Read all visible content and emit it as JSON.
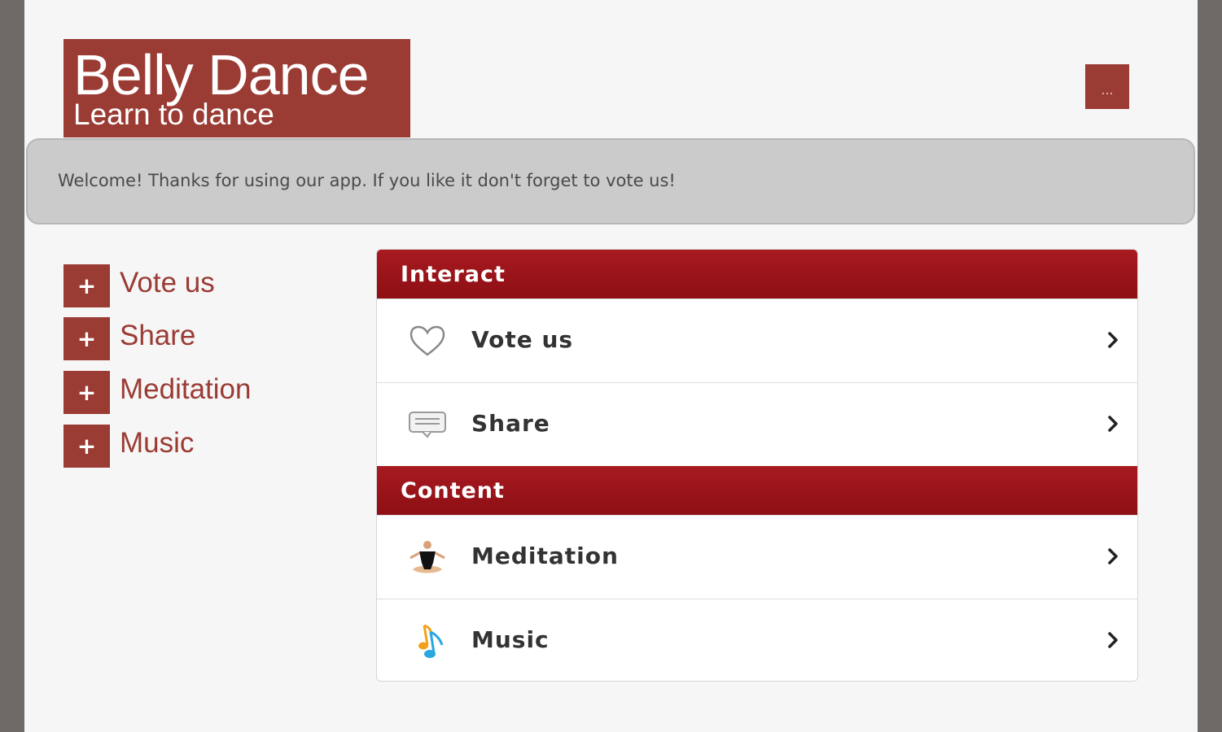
{
  "header": {
    "title": "Belly Dance",
    "subtitle": "Learn to dance",
    "more_label": "..."
  },
  "welcome": {
    "text": "Welcome! Thanks for using our app. If you like it don't forget to vote us!"
  },
  "side_nav": {
    "items": [
      {
        "icon": "+",
        "label": "Vote us"
      },
      {
        "icon": "+",
        "label": "Share"
      },
      {
        "icon": "+",
        "label": "Meditation"
      },
      {
        "icon": "+",
        "label": "Music"
      }
    ]
  },
  "sections": [
    {
      "title": "Interact",
      "items": [
        {
          "label": "Vote us",
          "icon": "heart-icon"
        },
        {
          "label": "Share",
          "icon": "speech-bubble-icon"
        }
      ]
    },
    {
      "title": "Content",
      "items": [
        {
          "label": "Meditation",
          "icon": "meditation-figure-icon"
        },
        {
          "label": "Music",
          "icon": "music-note-icon"
        }
      ]
    }
  ],
  "colors": {
    "brand": "#9a3b34",
    "section_header": "#9e161b",
    "page_background": "#f6f6f6",
    "welcome_bar": "#cbcbcb"
  }
}
